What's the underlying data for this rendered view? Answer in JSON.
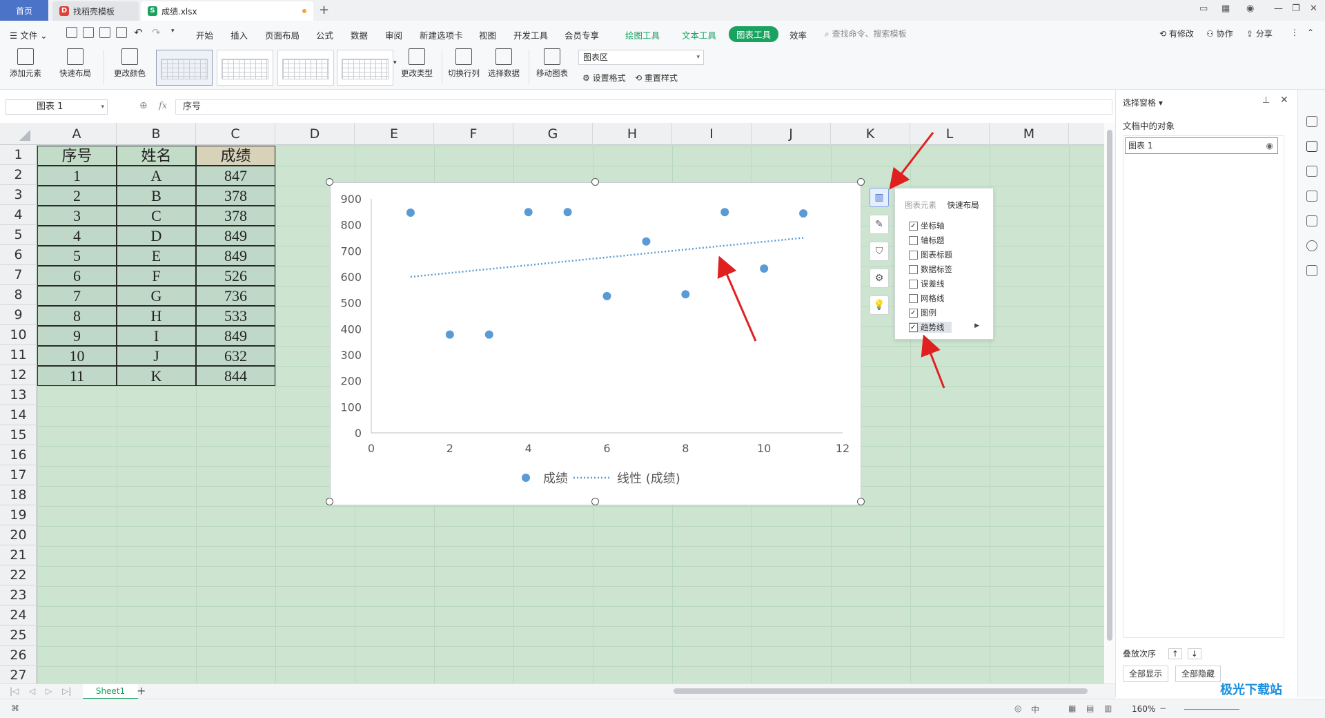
{
  "titlebar": {
    "tabs": [
      {
        "label": "首页"
      },
      {
        "label": "找稻壳模板"
      },
      {
        "label": "成绩.xlsx"
      }
    ]
  },
  "menu": {
    "file": "文件",
    "items": [
      "开始",
      "插入",
      "页面布局",
      "公式",
      "数据",
      "审阅",
      "新建选项卡",
      "视图",
      "开发工具",
      "会员专享"
    ],
    "tool_tabs": [
      "绘图工具",
      "文本工具",
      "图表工具"
    ],
    "efficiency": "效率",
    "search_placeholder": "查找命令、搜索模板",
    "right_actions": [
      "有修改",
      "协作",
      "分享"
    ]
  },
  "ribbon": {
    "add_element": "添加元素",
    "quick_layout": "快速布局",
    "change_color": "更改颜色",
    "change_type": "更改类型",
    "switch_rowcol": "切换行列",
    "select_data": "选择数据",
    "move_chart": "移动图表",
    "area_select": "图表区",
    "set_format": "设置格式",
    "reset_style": "重置样式"
  },
  "formula": {
    "namebox": "图表 1",
    "fx": "fx",
    "content": "序号"
  },
  "sheet": {
    "columns": [
      "A",
      "B",
      "C",
      "D",
      "E",
      "F",
      "G",
      "H",
      "I",
      "J",
      "K",
      "L",
      "M"
    ],
    "rows": [
      "1",
      "2",
      "3",
      "4",
      "5",
      "6",
      "7",
      "8",
      "9",
      "10",
      "11",
      "12",
      "13",
      "14",
      "15",
      "16",
      "17",
      "18",
      "19",
      "20",
      "21",
      "22",
      "23",
      "24",
      "25",
      "26",
      "27"
    ],
    "headers": [
      "序号",
      "姓名",
      "成绩"
    ],
    "data": [
      [
        "1",
        "A",
        "847"
      ],
      [
        "2",
        "B",
        "378"
      ],
      [
        "3",
        "C",
        "378"
      ],
      [
        "4",
        "D",
        "849"
      ],
      [
        "5",
        "E",
        "849"
      ],
      [
        "6",
        "F",
        "526"
      ],
      [
        "7",
        "G",
        "736"
      ],
      [
        "8",
        "H",
        "533"
      ],
      [
        "9",
        "I",
        "849"
      ],
      [
        "10",
        "J",
        "632"
      ],
      [
        "11",
        "K",
        "844"
      ]
    ],
    "tab": "Sheet1"
  },
  "chart_data": {
    "type": "scatter",
    "x": [
      1,
      2,
      3,
      4,
      5,
      6,
      7,
      8,
      9,
      10,
      11
    ],
    "series": [
      {
        "name": "成绩",
        "values": [
          847,
          378,
          378,
          849,
          849,
          526,
          736,
          533,
          849,
          632,
          844
        ]
      }
    ],
    "trendline": {
      "name": "线性 (成绩)",
      "type": "linear",
      "start": [
        1,
        600
      ],
      "end": [
        11,
        750
      ]
    },
    "xlim": [
      0,
      12
    ],
    "ylim": [
      0,
      900
    ],
    "xticks": [
      "0",
      "2",
      "4",
      "6",
      "8",
      "10",
      "12"
    ],
    "yticks": [
      "0",
      "100",
      "200",
      "300",
      "400",
      "500",
      "600",
      "700",
      "800",
      "900"
    ],
    "legend_position": "bottom",
    "grid": false,
    "color": "#5b9bd5"
  },
  "popup": {
    "tabs": [
      "图表元素",
      "快速布局"
    ],
    "items": [
      {
        "label": "坐标轴",
        "checked": true
      },
      {
        "label": "轴标题",
        "checked": false
      },
      {
        "label": "图表标题",
        "checked": false
      },
      {
        "label": "数据标签",
        "checked": false
      },
      {
        "label": "误差线",
        "checked": false
      },
      {
        "label": "网格线",
        "checked": false
      },
      {
        "label": "图例",
        "checked": true
      },
      {
        "label": "趋势线",
        "checked": true
      }
    ]
  },
  "rpane": {
    "title": "选择窗格",
    "subtitle": "文档中的对象",
    "item": "图表 1",
    "order_label": "叠放次序",
    "show_all": "全部显示",
    "hide_all": "全部隐藏"
  },
  "status": {
    "zoom": "160%"
  },
  "watermark": "极光下载站"
}
